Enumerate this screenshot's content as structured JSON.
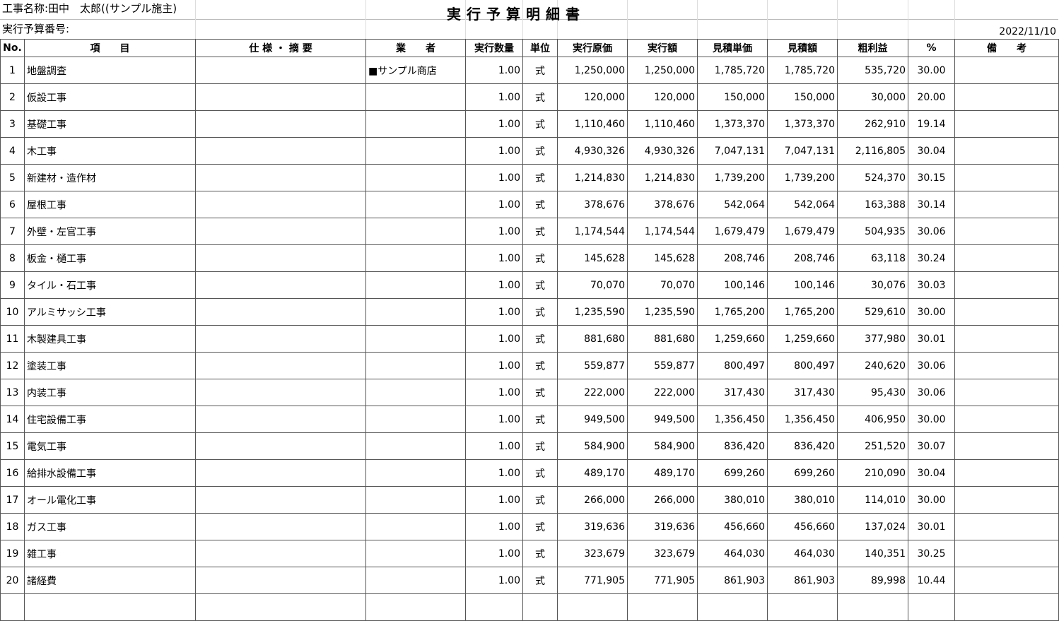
{
  "header": {
    "project_name": "工事名称:田中　太郎((サンプル施主)",
    "budget_number": "実行予算番号:",
    "title": "実行予算明細書",
    "date": "2022/11/10"
  },
  "columns": [
    "No.",
    "項　　目",
    "仕 様 ・ 摘 要",
    "業　　者",
    "実行数量",
    "単位",
    "実行原価",
    "実行額",
    "見積単価",
    "見積額",
    "粗利益",
    "%",
    "備　　考"
  ],
  "rows": [
    {
      "no": "1",
      "item": "地盤調査",
      "spec": "",
      "vendor": "■サンプル商店",
      "qty": "1.00",
      "unit": "式",
      "cost": "1,250,000",
      "amount": "1,250,000",
      "est_unit": "1,785,720",
      "est_amount": "1,785,720",
      "profit": "535,720",
      "pct": "30.00",
      "note": ""
    },
    {
      "no": "2",
      "item": "仮設工事",
      "spec": "",
      "vendor": "",
      "qty": "1.00",
      "unit": "式",
      "cost": "120,000",
      "amount": "120,000",
      "est_unit": "150,000",
      "est_amount": "150,000",
      "profit": "30,000",
      "pct": "20.00",
      "note": ""
    },
    {
      "no": "3",
      "item": "基礎工事",
      "spec": "",
      "vendor": "",
      "qty": "1.00",
      "unit": "式",
      "cost": "1,110,460",
      "amount": "1,110,460",
      "est_unit": "1,373,370",
      "est_amount": "1,373,370",
      "profit": "262,910",
      "pct": "19.14",
      "note": ""
    },
    {
      "no": "4",
      "item": "木工事",
      "spec": "",
      "vendor": "",
      "qty": "1.00",
      "unit": "式",
      "cost": "4,930,326",
      "amount": "4,930,326",
      "est_unit": "7,047,131",
      "est_amount": "7,047,131",
      "profit": "2,116,805",
      "pct": "30.04",
      "note": ""
    },
    {
      "no": "5",
      "item": "新建材・造作材",
      "spec": "",
      "vendor": "",
      "qty": "1.00",
      "unit": "式",
      "cost": "1,214,830",
      "amount": "1,214,830",
      "est_unit": "1,739,200",
      "est_amount": "1,739,200",
      "profit": "524,370",
      "pct": "30.15",
      "note": ""
    },
    {
      "no": "6",
      "item": "屋根工事",
      "spec": "",
      "vendor": "",
      "qty": "1.00",
      "unit": "式",
      "cost": "378,676",
      "amount": "378,676",
      "est_unit": "542,064",
      "est_amount": "542,064",
      "profit": "163,388",
      "pct": "30.14",
      "note": ""
    },
    {
      "no": "7",
      "item": "外壁・左官工事",
      "spec": "",
      "vendor": "",
      "qty": "1.00",
      "unit": "式",
      "cost": "1,174,544",
      "amount": "1,174,544",
      "est_unit": "1,679,479",
      "est_amount": "1,679,479",
      "profit": "504,935",
      "pct": "30.06",
      "note": ""
    },
    {
      "no": "8",
      "item": "板金・樋工事",
      "spec": "",
      "vendor": "",
      "qty": "1.00",
      "unit": "式",
      "cost": "145,628",
      "amount": "145,628",
      "est_unit": "208,746",
      "est_amount": "208,746",
      "profit": "63,118",
      "pct": "30.24",
      "note": ""
    },
    {
      "no": "9",
      "item": "タイル・石工事",
      "spec": "",
      "vendor": "",
      "qty": "1.00",
      "unit": "式",
      "cost": "70,070",
      "amount": "70,070",
      "est_unit": "100,146",
      "est_amount": "100,146",
      "profit": "30,076",
      "pct": "30.03",
      "note": ""
    },
    {
      "no": "10",
      "item": "アルミサッシ工事",
      "spec": "",
      "vendor": "",
      "qty": "1.00",
      "unit": "式",
      "cost": "1,235,590",
      "amount": "1,235,590",
      "est_unit": "1,765,200",
      "est_amount": "1,765,200",
      "profit": "529,610",
      "pct": "30.00",
      "note": ""
    },
    {
      "no": "11",
      "item": "木製建具工事",
      "spec": "",
      "vendor": "",
      "qty": "1.00",
      "unit": "式",
      "cost": "881,680",
      "amount": "881,680",
      "est_unit": "1,259,660",
      "est_amount": "1,259,660",
      "profit": "377,980",
      "pct": "30.01",
      "note": ""
    },
    {
      "no": "12",
      "item": "塗装工事",
      "spec": "",
      "vendor": "",
      "qty": "1.00",
      "unit": "式",
      "cost": "559,877",
      "amount": "559,877",
      "est_unit": "800,497",
      "est_amount": "800,497",
      "profit": "240,620",
      "pct": "30.06",
      "note": ""
    },
    {
      "no": "13",
      "item": "内装工事",
      "spec": "",
      "vendor": "",
      "qty": "1.00",
      "unit": "式",
      "cost": "222,000",
      "amount": "222,000",
      "est_unit": "317,430",
      "est_amount": "317,430",
      "profit": "95,430",
      "pct": "30.06",
      "note": ""
    },
    {
      "no": "14",
      "item": "住宅設備工事",
      "spec": "",
      "vendor": "",
      "qty": "1.00",
      "unit": "式",
      "cost": "949,500",
      "amount": "949,500",
      "est_unit": "1,356,450",
      "est_amount": "1,356,450",
      "profit": "406,950",
      "pct": "30.00",
      "note": ""
    },
    {
      "no": "15",
      "item": "電気工事",
      "spec": "",
      "vendor": "",
      "qty": "1.00",
      "unit": "式",
      "cost": "584,900",
      "amount": "584,900",
      "est_unit": "836,420",
      "est_amount": "836,420",
      "profit": "251,520",
      "pct": "30.07",
      "note": ""
    },
    {
      "no": "16",
      "item": "給排水設備工事",
      "spec": "",
      "vendor": "",
      "qty": "1.00",
      "unit": "式",
      "cost": "489,170",
      "amount": "489,170",
      "est_unit": "699,260",
      "est_amount": "699,260",
      "profit": "210,090",
      "pct": "30.04",
      "note": ""
    },
    {
      "no": "17",
      "item": "オール電化工事",
      "spec": "",
      "vendor": "",
      "qty": "1.00",
      "unit": "式",
      "cost": "266,000",
      "amount": "266,000",
      "est_unit": "380,010",
      "est_amount": "380,010",
      "profit": "114,010",
      "pct": "30.00",
      "note": ""
    },
    {
      "no": "18",
      "item": "ガス工事",
      "spec": "",
      "vendor": "",
      "qty": "1.00",
      "unit": "式",
      "cost": "319,636",
      "amount": "319,636",
      "est_unit": "456,660",
      "est_amount": "456,660",
      "profit": "137,024",
      "pct": "30.01",
      "note": ""
    },
    {
      "no": "19",
      "item": "雑工事",
      "spec": "",
      "vendor": "",
      "qty": "1.00",
      "unit": "式",
      "cost": "323,679",
      "amount": "323,679",
      "est_unit": "464,030",
      "est_amount": "464,030",
      "profit": "140,351",
      "pct": "30.25",
      "note": ""
    },
    {
      "no": "20",
      "item": "諸経費",
      "spec": "",
      "vendor": "",
      "qty": "1.00",
      "unit": "式",
      "cost": "771,905",
      "amount": "771,905",
      "est_unit": "861,903",
      "est_amount": "861,903",
      "profit": "89,998",
      "pct": "10.44",
      "note": ""
    },
    {
      "no": "",
      "item": "",
      "spec": "",
      "vendor": "",
      "qty": "",
      "unit": "",
      "cost": "",
      "amount": "",
      "est_unit": "",
      "est_amount": "",
      "profit": "",
      "pct": "",
      "note": ""
    }
  ]
}
